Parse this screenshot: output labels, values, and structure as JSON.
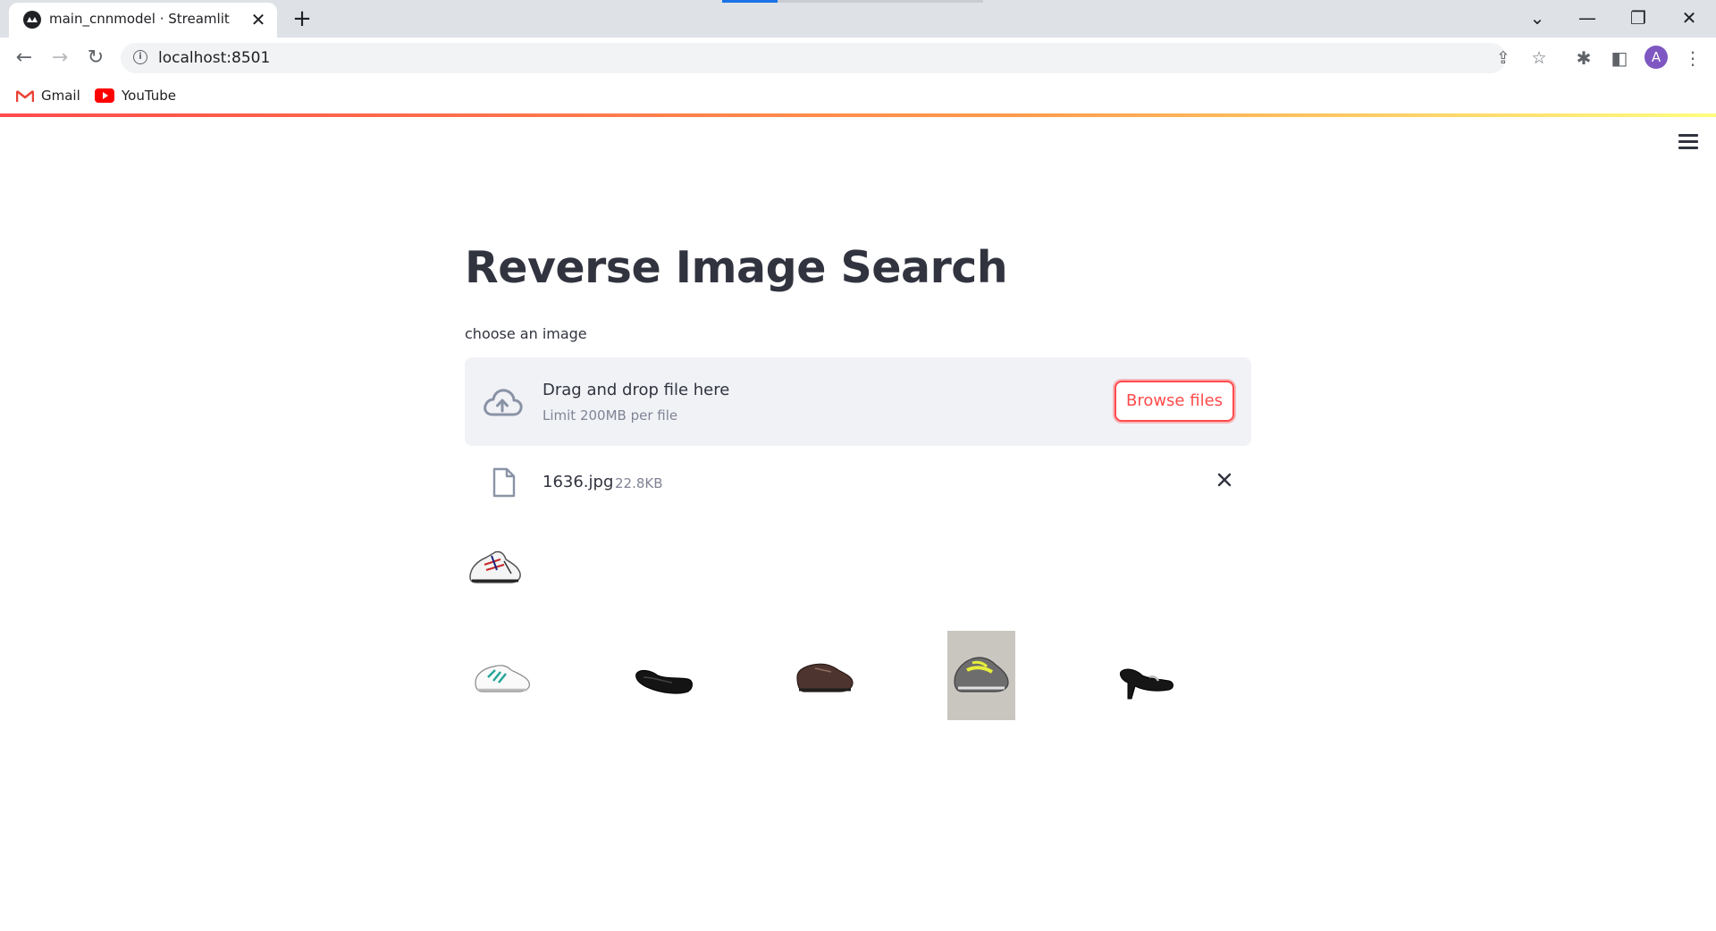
{
  "browser": {
    "tab_title": "main_cnnmodel · Streamlit",
    "url": "localhost:8501",
    "avatar_letter": "A",
    "bookmarks": [
      {
        "label": "Gmail",
        "icon": "gmail-icon"
      },
      {
        "label": "YouTube",
        "icon": "youtube-icon"
      }
    ]
  },
  "app": {
    "title": "Reverse Image Search",
    "uploader_label": "choose an image",
    "dropzone": {
      "text": "Drag and drop file here",
      "limit": "Limit 200MB per file",
      "browse_label": "Browse files"
    },
    "uploaded_file": {
      "name": "1636.jpg",
      "size": "22.8KB"
    },
    "query_image": {
      "description_icon": "white-sneaker-image"
    },
    "results": [
      {
        "icon": "white-teal-sneaker-image"
      },
      {
        "icon": "black-flat-shoe-image"
      },
      {
        "icon": "brown-casual-shoe-image"
      },
      {
        "icon": "grey-yellow-running-shoe-image"
      },
      {
        "icon": "black-heel-shoe-image"
      }
    ]
  },
  "colors": {
    "accent": "#ff4b4b",
    "text": "#31333f",
    "muted": "#808495",
    "dropzone_bg": "#f0f2f6"
  }
}
